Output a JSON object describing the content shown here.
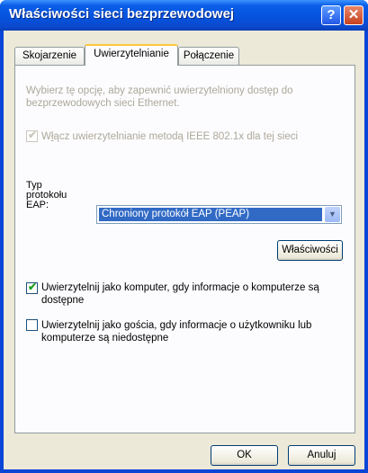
{
  "window": {
    "title": "Właściwości sieci bezprzewodowej",
    "help_label": "?",
    "close_label": "✕"
  },
  "tabs": [
    {
      "label": "Skojarzenie"
    },
    {
      "label": "Uwierzytelnianie",
      "active": true
    },
    {
      "label": "Połączenie"
    }
  ],
  "auth": {
    "description": "Wybierz tę opcję, aby zapewnić uwierzytelniony dostęp do bezprzewodowych sieci Ethernet.",
    "enable_8021x": {
      "label_pre": "W",
      "label_u": "ł",
      "label_post": "ącz uwierzytelnianie metodą IEEE 802.1x dla tej sieci",
      "checked": true,
      "disabled": true
    },
    "eap_type_label_line1": "Typ",
    "eap_type_label_line2": "protokołu",
    "eap_type_label_line3": "EAP:",
    "eap_type_value": "Chroniony protokół EAP (PEAP)",
    "properties_button": "Właściwości",
    "auth_as_computer": {
      "label_line1": "Uwierzytelnij jako komputer, gdy informacje o komputerze są",
      "label_line2": "dostępne",
      "checked": true
    },
    "auth_as_guest": {
      "label_line1": "Uwierzytelnij jako gościa, gdy informacje o użytkowniku lub",
      "label_line2": "komputerze są niedostępne",
      "checked": false
    }
  },
  "footer": {
    "ok_label": "OK",
    "cancel_label": "Anuluj"
  }
}
